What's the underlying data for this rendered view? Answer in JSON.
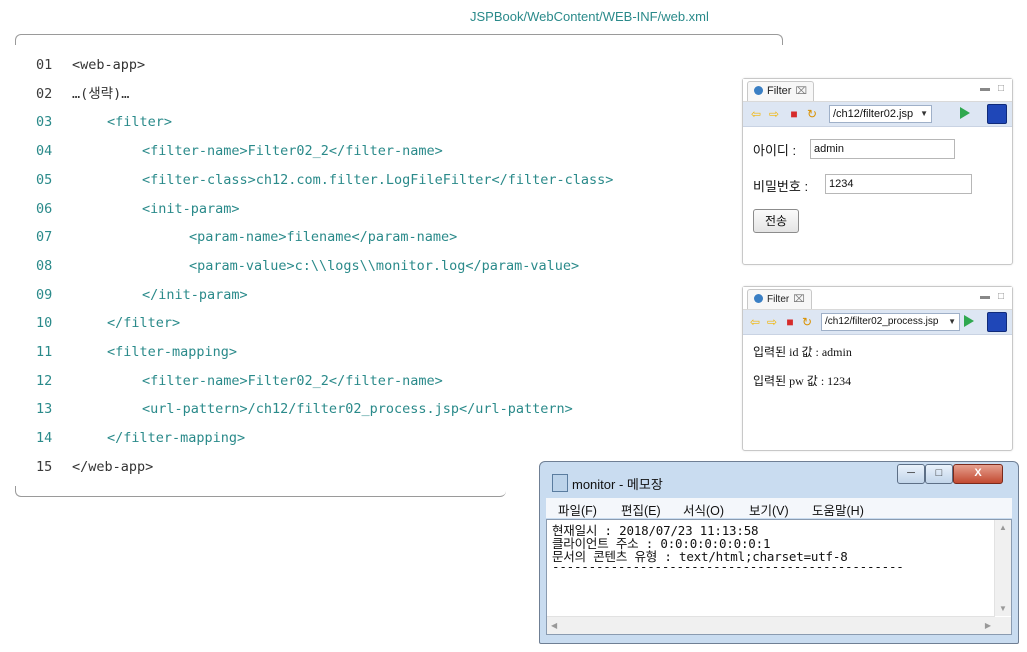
{
  "file_path": "JSPBook/WebContent/WEB-INF/web.xml",
  "code_lines": [
    {
      "num": "01",
      "text": "<web-app>"
    },
    {
      "num": "02",
      "text": "…(생략)…"
    },
    {
      "num": "03",
      "text": "<filter>"
    },
    {
      "num": "04",
      "text": "<filter-name>Filter02_2</filter-name>"
    },
    {
      "num": "05",
      "text": "<filter-class>ch12.com.filter.LogFileFilter</filter-class>"
    },
    {
      "num": "06",
      "text": "<init-param>"
    },
    {
      "num": "07",
      "text": "<param-name>filename</param-name>"
    },
    {
      "num": "08",
      "text": "<param-value>c:\\\\logs\\\\monitor.log</param-value>"
    },
    {
      "num": "09",
      "text": "</init-param>"
    },
    {
      "num": "10",
      "text": "</filter>"
    },
    {
      "num": "11",
      "text": "<filter-mapping>"
    },
    {
      "num": "12",
      "text": "<filter-name>Filter02_2</filter-name>"
    },
    {
      "num": "13",
      "text": "<url-pattern>/ch12/filter02_process.jsp</url-pattern>"
    },
    {
      "num": "14",
      "text": "</filter-mapping>"
    },
    {
      "num": "15",
      "text": "</web-app>"
    }
  ],
  "browser1": {
    "tab_label": "Filter",
    "tab_close": "⌧",
    "url": "/ch12/filter02.jsp",
    "id_label": "아이디 :",
    "id_value": "admin",
    "pw_label": "비밀번호 :",
    "pw_value": "1234",
    "submit_label": "전송"
  },
  "browser2": {
    "tab_label": "Filter",
    "tab_close": "⌧",
    "url": "/ch12/filter02_process.jsp",
    "result_id": "입력된 id 값 : admin",
    "result_pw": "입력된 pw 값 : 1234"
  },
  "notepad": {
    "title": "monitor - 메모장",
    "menu": [
      "파일(F)",
      "편집(E)",
      "서식(O)",
      "보기(V)",
      "도움말(H)"
    ],
    "lines": [
      "현재일시 : 2018/07/23 11:13:58",
      "클라이언트 주소 : 0:0:0:0:0:0:0:1",
      "문서의 콘텐츠 유형 : text/html;charset=utf-8",
      "------------------------------------------------"
    ],
    "min_label": "─",
    "max_label": "□",
    "close_label": "X"
  }
}
